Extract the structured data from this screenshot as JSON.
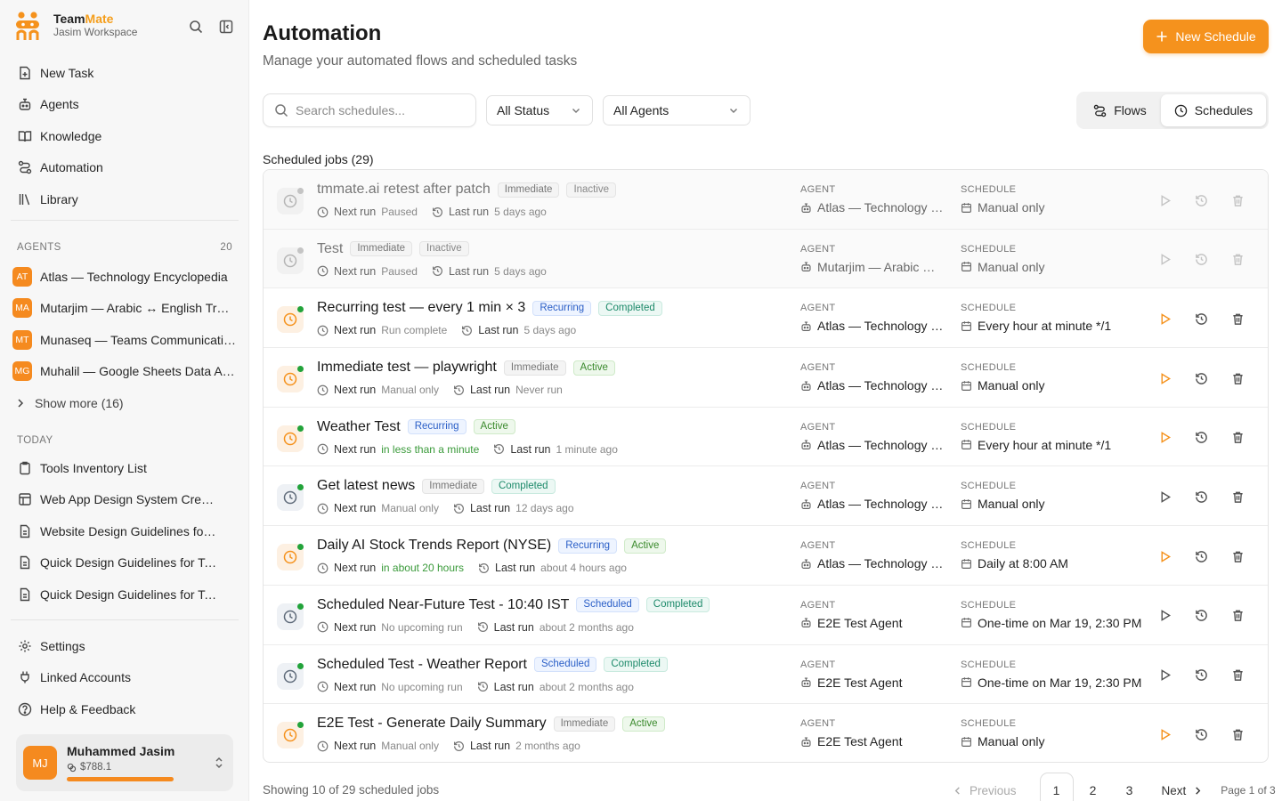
{
  "brand": {
    "name_part1": "Team",
    "name_part2": "Mate",
    "workspace": "Jasim Workspace"
  },
  "nav": [
    {
      "label": "New Task",
      "icon": "new-task-icon"
    },
    {
      "label": "Agents",
      "icon": "robot-icon"
    },
    {
      "label": "Knowledge",
      "icon": "book-icon"
    },
    {
      "label": "Automation",
      "icon": "route-icon"
    },
    {
      "label": "Library",
      "icon": "library-icon"
    }
  ],
  "agents_section": {
    "title": "AGENTS",
    "count": "20",
    "show_more": "Show more (16)"
  },
  "agents": [
    {
      "initials": "AT",
      "name": "Atlas — Technology Encyclopedia"
    },
    {
      "initials": "MA",
      "name": "Mutarjim — Arabic ↔ English Translator"
    },
    {
      "initials": "MT",
      "name": "Munaseq — Teams Communication"
    },
    {
      "initials": "MG",
      "name": "Muhalil — Google Sheets Data Analyst"
    }
  ],
  "today_section": {
    "title": "TODAY"
  },
  "today": [
    {
      "label": "Tools Inventory List",
      "icon": "clipboard-icon"
    },
    {
      "label": "Web App Design System Creation",
      "icon": "layout-icon"
    },
    {
      "label": "Website Design Guidelines for Teams",
      "icon": "document-icon"
    },
    {
      "label": "Quick Design Guidelines for Teams",
      "icon": "document-icon"
    },
    {
      "label": "Quick Design Guidelines for Teams",
      "icon": "document-icon"
    }
  ],
  "bottom_nav": [
    {
      "label": "Settings",
      "icon": "gear-icon"
    },
    {
      "label": "Linked Accounts",
      "icon": "plug-icon"
    },
    {
      "label": "Help & Feedback",
      "icon": "help-icon"
    }
  ],
  "user": {
    "initials": "MJ",
    "name": "Muhammed Jasim",
    "credit": "$788.1"
  },
  "page": {
    "title": "Automation",
    "subtitle": "Manage your automated flows and scheduled tasks",
    "new_button": "New Schedule",
    "search_placeholder": "Search schedules...",
    "status_filter": "All Status",
    "agent_filter": "All Agents",
    "toggle_flows": "Flows",
    "toggle_schedules": "Schedules",
    "section_title": "Scheduled jobs (29)",
    "agent_col_label": "AGENT",
    "schedule_col_label": "SCHEDULE",
    "next_run_label": "Next run",
    "last_run_label": "Last run"
  },
  "jobs": [
    {
      "name": "tmmate.ai retest after patch",
      "badges": [
        [
          "Immediate",
          "immediate"
        ],
        [
          "Inactive",
          "inactive"
        ]
      ],
      "next_run": "Paused",
      "last_run": "5 days ago",
      "agent": "Atlas — Technology Encyclopedia",
      "schedule": "Manual only",
      "state": "inactive"
    },
    {
      "name": "Test",
      "badges": [
        [
          "Immediate",
          "immediate"
        ],
        [
          "Inactive",
          "inactive"
        ]
      ],
      "next_run": "Paused",
      "last_run": "5 days ago",
      "agent": "Mutarjim — Arabic ↔ English Translator",
      "schedule": "Manual only",
      "state": "inactive"
    },
    {
      "name": "Recurring test — every 1 min × 3",
      "badges": [
        [
          "Recurring",
          "recurring"
        ],
        [
          "Completed",
          "completed"
        ]
      ],
      "next_run": "Run complete",
      "last_run": "5 days ago",
      "agent": "Atlas — Technology Encyclopedia",
      "schedule": "Every hour at minute */1",
      "state": "active"
    },
    {
      "name": "Immediate test — playwright",
      "badges": [
        [
          "Immediate",
          "immediate"
        ],
        [
          "Active",
          "active"
        ]
      ],
      "next_run": "Manual only",
      "last_run": "Never run",
      "agent": "Atlas — Technology Encyclopedia",
      "schedule": "Manual only",
      "state": "active"
    },
    {
      "name": "Weather Test",
      "badges": [
        [
          "Recurring",
          "recurring"
        ],
        [
          "Active",
          "active"
        ]
      ],
      "next_run": "in less than a minute",
      "next_green": true,
      "last_run": "1 minute ago",
      "agent": "Atlas — Technology Encyclopedia",
      "schedule": "Every hour at minute */1",
      "state": "active"
    },
    {
      "name": "Get latest news",
      "badges": [
        [
          "Immediate",
          "immediate"
        ],
        [
          "Completed",
          "completed"
        ]
      ],
      "next_run": "Manual only",
      "last_run": "12 days ago",
      "agent": "Atlas — Technology Encyclopedia",
      "schedule": "Manual only",
      "state": "done"
    },
    {
      "name": "Daily AI Stock Trends Report (NYSE)",
      "badges": [
        [
          "Recurring",
          "recurring"
        ],
        [
          "Active",
          "active"
        ]
      ],
      "next_run": "in about 20 hours",
      "next_green": true,
      "last_run": "about 4 hours ago",
      "agent": "Atlas — Technology Encyclopedia",
      "schedule": "Daily at 8:00 AM",
      "state": "active"
    },
    {
      "name": "Scheduled Near-Future Test - 10:40 IST",
      "badges": [
        [
          "Scheduled",
          "scheduled"
        ],
        [
          "Completed",
          "completed"
        ]
      ],
      "next_run": "No upcoming run",
      "last_run": "about 2 months ago",
      "agent": "E2E Test Agent",
      "schedule": "One-time on Mar 19, 2:30 PM",
      "state": "done"
    },
    {
      "name": "Scheduled Test - Weather Report",
      "badges": [
        [
          "Scheduled",
          "scheduled"
        ],
        [
          "Completed",
          "completed"
        ]
      ],
      "next_run": "No upcoming run",
      "last_run": "about 2 months ago",
      "agent": "E2E Test Agent",
      "schedule": "One-time on Mar 19, 2:30 PM",
      "state": "done"
    },
    {
      "name": "E2E Test - Generate Daily Summary",
      "badges": [
        [
          "Immediate",
          "immediate"
        ],
        [
          "Active",
          "active"
        ]
      ],
      "next_run": "Manual only",
      "last_run": "2 months ago",
      "agent": "E2E Test Agent",
      "schedule": "Manual only",
      "state": "active"
    }
  ],
  "footer": {
    "showing": "Showing 10 of 29 scheduled jobs",
    "previous": "Previous",
    "pages": [
      "1",
      "2",
      "3"
    ],
    "next": "Next",
    "page_info": "Page 1 of 3"
  },
  "colors": {
    "accent": "#f5921d",
    "avatar": "#f58a1f",
    "green_dot": "#22a33a",
    "grey_dot": "#c4c4c4"
  }
}
